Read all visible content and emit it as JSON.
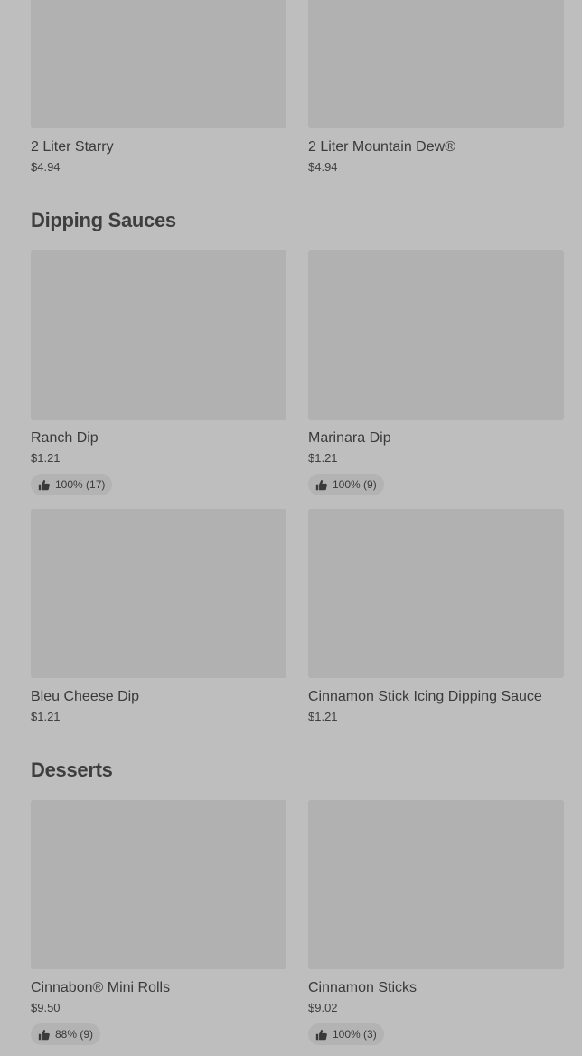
{
  "drinks": {
    "items": [
      {
        "name": "2 Liter Starry",
        "price": "$4.94"
      },
      {
        "name": "2 Liter Mountain Dew®",
        "price": "$4.94"
      }
    ]
  },
  "dipping_sauces": {
    "title": "Dipping Sauces",
    "items": [
      {
        "name": "Ranch Dip",
        "price": "$1.21",
        "rating": "100% (17)"
      },
      {
        "name": "Marinara Dip",
        "price": "$1.21",
        "rating": "100% (9)"
      },
      {
        "name": "Bleu Cheese Dip",
        "price": "$1.21"
      },
      {
        "name": "Cinnamon Stick Icing Dipping Sauce",
        "price": "$1.21"
      }
    ]
  },
  "desserts": {
    "title": "Desserts",
    "items": [
      {
        "name": "Cinnabon® Mini Rolls",
        "price": "$9.50",
        "rating": "88% (9)"
      },
      {
        "name": "Cinnamon Sticks",
        "price": "$9.02",
        "rating": "100% (3)"
      }
    ]
  },
  "icons": {
    "rating": "thumbs-up-icon"
  },
  "colors": {
    "background": "#bebebe",
    "thumbnail": "#b1b1b1",
    "badge": "#b3b3b3"
  }
}
